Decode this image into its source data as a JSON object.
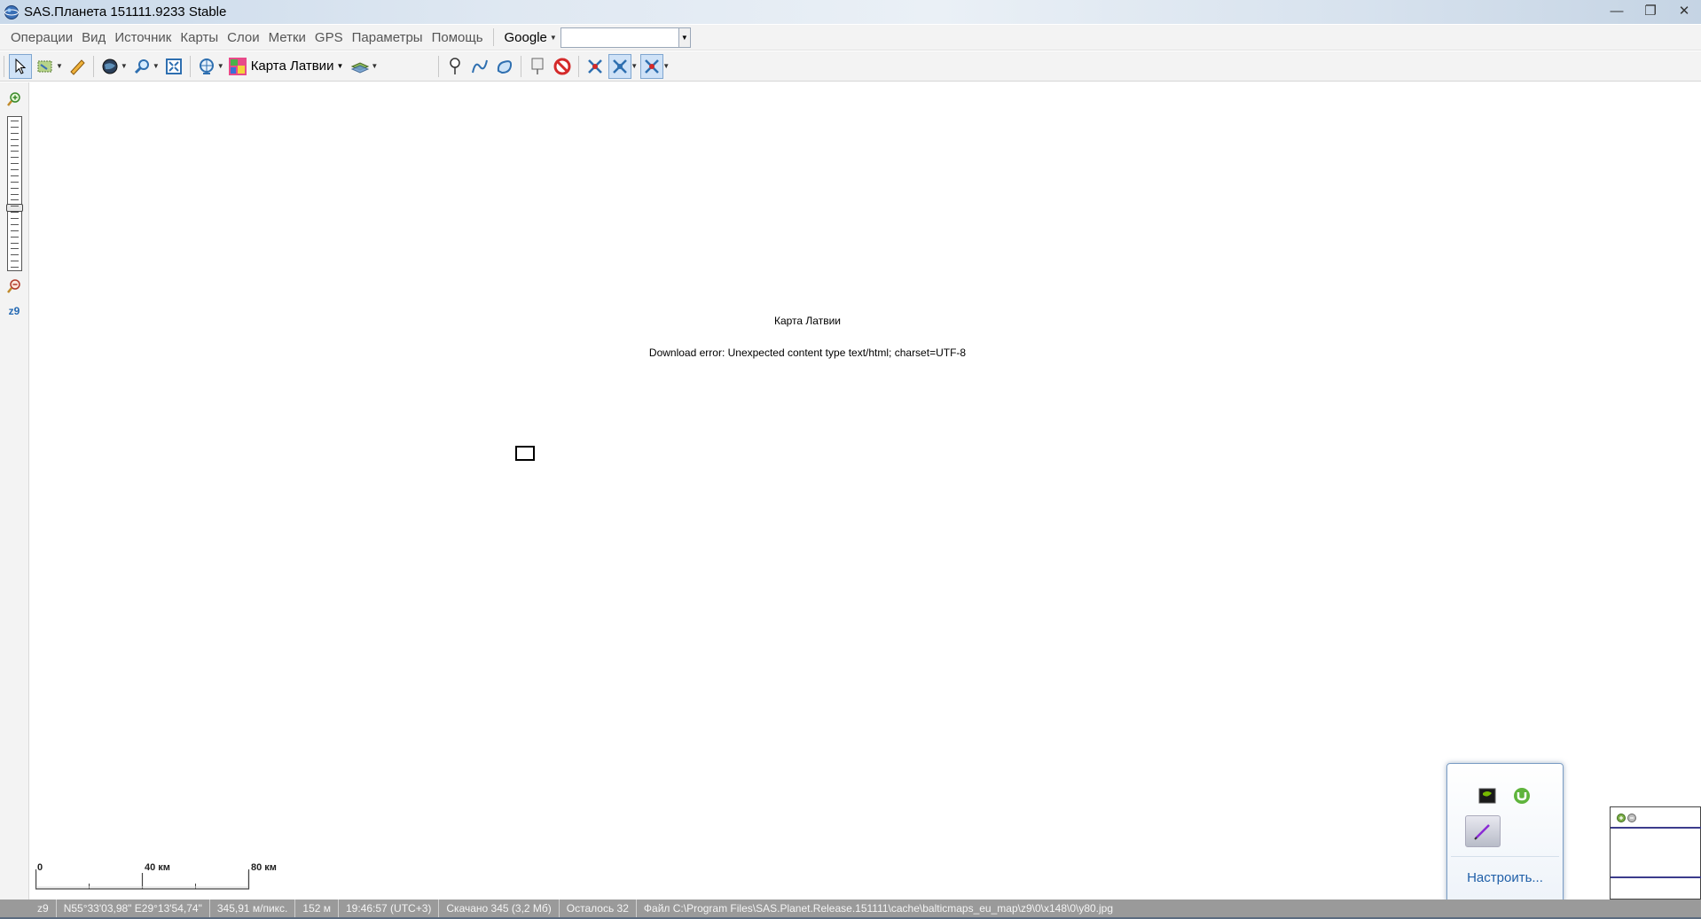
{
  "window": {
    "title": "SAS.Планета 151111.9233 Stable",
    "minimize": "—",
    "maximize": "❐",
    "close": "✕"
  },
  "menu": {
    "items": [
      "Операции",
      "Вид",
      "Источник",
      "Карты",
      "Слои",
      "Метки",
      "GPS",
      "Параметры",
      "Помощь"
    ],
    "search_engine": "Google",
    "search_value": ""
  },
  "toolbar": {
    "map_name": "Карта Латвии"
  },
  "zoom": {
    "level_label": "z9",
    "level_fraction": 0.6
  },
  "map": {
    "tile_title": "Карта Латвии",
    "tile_error": "Download error: Unexpected content type text/html; charset=UTF-8",
    "scale_labels": [
      "0",
      "40 км",
      "80 км"
    ]
  },
  "tray": {
    "customize_label": "Настроить..."
  },
  "statusbar": {
    "zoom": "z9",
    "coords": "N55°33'03,98\" E29°13'54,74\"",
    "resolution": "345,91 м/пикс.",
    "elevation": "152 м",
    "time": "19:46:57 (UTC+3)",
    "downloaded": "Скачано 345 (3,2 Мб)",
    "remaining": "Осталось 32",
    "file": "Файл C:\\Program Files\\SAS.Planet.Release.151111\\cache\\balticmaps_eu_map\\z9\\0\\x148\\0\\y80.jpg"
  },
  "colors": {
    "accent": "#2469b3",
    "statusbar_bg": "#9a9a9a"
  }
}
